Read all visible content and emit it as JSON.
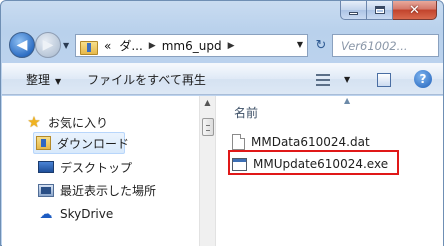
{
  "window": {
    "caption_buttons": {
      "minimize": "",
      "maximize": "",
      "close": "✕"
    }
  },
  "nav": {
    "address": {
      "overflow": "«",
      "crumb1": "ダ...",
      "crumb2": "mm6_upd"
    },
    "search_placeholder": "Ver61002..."
  },
  "toolbar": {
    "organize_label": "整理",
    "play_all_label": "ファイルをすべて再生",
    "help_label": "?"
  },
  "sidebar": {
    "items": [
      {
        "label": "お気に入り",
        "icon": "star-icon"
      },
      {
        "label": "ダウンロード",
        "icon": "downloads-folder-icon",
        "selected": true
      },
      {
        "label": "デスクトップ",
        "icon": "desktop-icon"
      },
      {
        "label": "最近表示した場所",
        "icon": "recent-places-icon"
      },
      {
        "label": "SkyDrive",
        "icon": "skydrive-cloud-icon"
      }
    ]
  },
  "files": {
    "column_name": "名前",
    "items": [
      {
        "name": "MMData610024.dat",
        "icon": "dat-file-icon"
      },
      {
        "name": "MMUpdate610024.exe",
        "icon": "exe-file-icon",
        "highlighted": true
      }
    ]
  },
  "colors": {
    "highlight": "#e01818",
    "selection": "#d8e9fb"
  }
}
